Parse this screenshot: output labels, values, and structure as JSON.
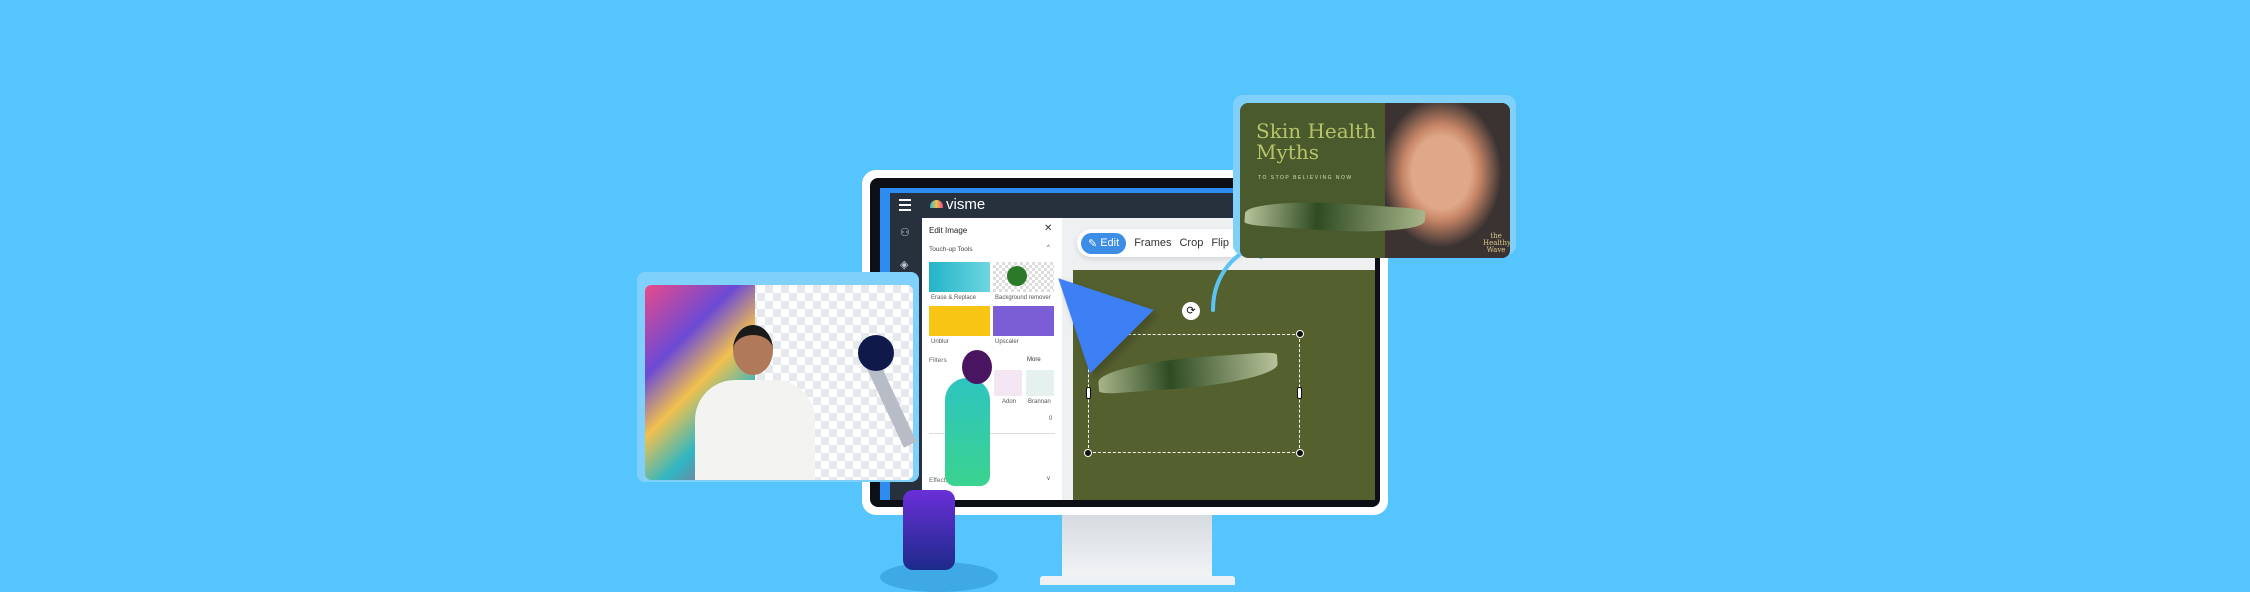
{
  "app": {
    "brand": "visme"
  },
  "panel": {
    "title": "Edit Image",
    "section_touchup": "Touch-up Tools",
    "tools": [
      "Erase & Replace",
      "Background remover",
      "Unblur",
      "Upscaler"
    ],
    "section_filters": "Filters",
    "more": "More",
    "filters": [
      "Adon",
      "Brannan"
    ],
    "filter_value": "0",
    "section_effects": "Effects"
  },
  "toolbar": {
    "items": [
      "Edit",
      "Frames",
      "Crop",
      "Flip"
    ]
  },
  "preview_card": {
    "title": "Skin Health Myths",
    "subtitle": "TO STOP BELIEVING NOW",
    "brand": "the Healthy Wave"
  },
  "colors": {
    "background": "#56c5fd",
    "accent": "#3b8de6",
    "canvas": "#55602f",
    "app_bar": "#27303d"
  },
  "icons": [
    "menu-icon",
    "pencil-icon",
    "close-icon",
    "chevron-up-icon",
    "chevron-down-icon",
    "rotate-icon",
    "cursor-arrow-icon",
    "curved-arrow-icon"
  ]
}
